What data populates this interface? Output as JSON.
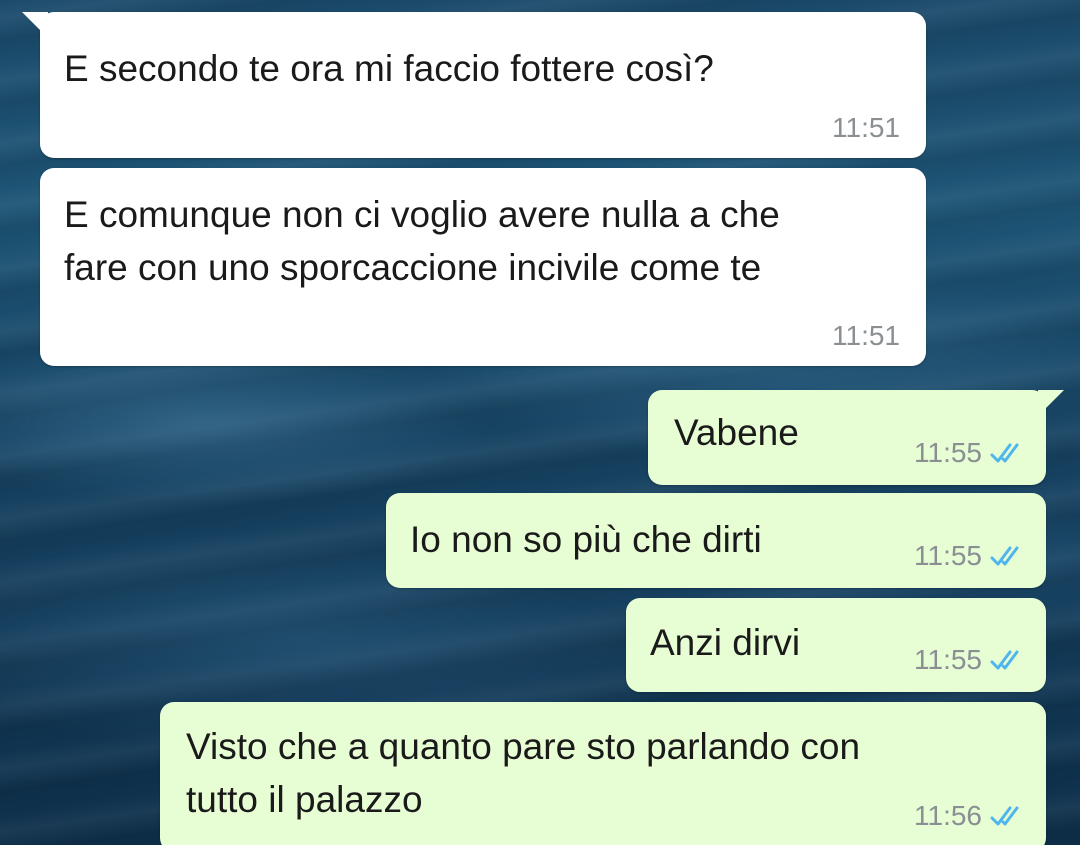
{
  "messages": [
    {
      "direction": "incoming",
      "text": "E secondo te ora mi faccio fottere così?",
      "time": "11:51"
    },
    {
      "direction": "incoming",
      "text": "E comunque non ci voglio avere nulla a che\nfare con uno sporcaccione incivile come te",
      "time": "11:51"
    },
    {
      "direction": "outgoing",
      "text": "Vabene",
      "time": "11:55",
      "status": "read",
      "status_icon": "double-check-icon"
    },
    {
      "direction": "outgoing",
      "text": "Io non so più che dirti",
      "time": "11:55",
      "status": "read",
      "status_icon": "double-check-icon"
    },
    {
      "direction": "outgoing",
      "text": "Anzi dirvi",
      "time": "11:55",
      "status": "read",
      "status_icon": "double-check-icon"
    },
    {
      "direction": "outgoing",
      "text": "Visto che a quanto pare sto parlando con\ntutto il palazzo",
      "time": "11:56",
      "status": "read",
      "status_icon": "double-check-icon"
    }
  ],
  "colors": {
    "incoming_bubble": "#ffffff",
    "outgoing_bubble": "#e7fdd4",
    "read_check": "#4fb6ec",
    "timestamp": "#8a8f93"
  }
}
